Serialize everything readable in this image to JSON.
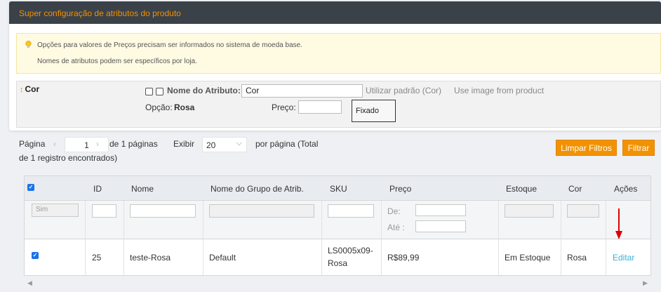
{
  "panel": {
    "title": "Super configuração de atributos do produto",
    "notice": {
      "line1": "Opções para valores de Preços precisam ser informados no sistema de moeda base.",
      "line2": "Nomes de atributos podem ser específicos por loja."
    },
    "attribute": {
      "name": "Cor",
      "name_label": "Nome do Atributo:",
      "name_value": "Cor",
      "use_default": "Utilizar padrão (Cor)",
      "use_image": "Use image from product",
      "option_label": "Opção:",
      "option_value": "Rosa",
      "price_label": "Preço:",
      "price_value": "",
      "price_type": "Fixado"
    }
  },
  "pager": {
    "page_label": "Página",
    "prev": "‹",
    "page": "1",
    "next": "›",
    "of_pages": "de 1 páginas",
    "show_label": "Exibir",
    "per_page": "20",
    "per_page_suffix": "por página (Total",
    "total_line": "de 1 registro encontrados)"
  },
  "buttons": {
    "clear_filters": "Limpar Filtros",
    "filter": "Filtrar"
  },
  "grid": {
    "columns": [
      "ID",
      "Nome",
      "Nome do Grupo de Atrib.",
      "SKU",
      "Preço",
      "Estoque",
      "Cor",
      "Ações"
    ],
    "filters": {
      "select": "Sim",
      "price_from": "De:",
      "price_to": "Até :"
    },
    "rows": [
      {
        "id": "25",
        "name": "teste-Rosa",
        "attr_set": "Default",
        "sku_line1": "LS0005x09-",
        "sku_line2": "Rosa",
        "price": "R$89,99",
        "stock": "Em Estoque",
        "color": "Rosa",
        "action": "Editar"
      }
    ]
  },
  "colors": {
    "accent": "#f29200",
    "header_bg": "#3a4149",
    "link": "#3ab0d6",
    "annotation_arrow": "#e00000"
  }
}
